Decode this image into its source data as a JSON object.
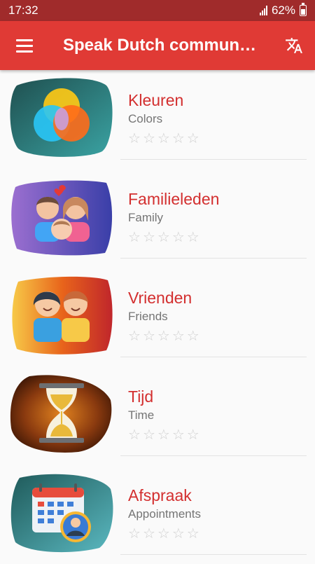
{
  "status": {
    "time": "17:32",
    "battery": "62%"
  },
  "app_bar": {
    "title": "Speak Dutch communic…"
  },
  "topics": [
    {
      "title": "Kleuren",
      "subtitle": "Colors",
      "icon": "colors-icon",
      "rating": 0
    },
    {
      "title": "Familieleden",
      "subtitle": "Family",
      "icon": "family-icon",
      "rating": 0
    },
    {
      "title": "Vrienden",
      "subtitle": "Friends",
      "icon": "friends-icon",
      "rating": 0
    },
    {
      "title": "Tijd",
      "subtitle": "Time",
      "icon": "hourglass-icon",
      "rating": 0
    },
    {
      "title": "Afspraak",
      "subtitle": "Appointments",
      "icon": "calendar-icon",
      "rating": 0
    }
  ],
  "colors": {
    "accent": "#e03a35",
    "status_bar": "#a02b2b",
    "title_text": "#d32f2f"
  }
}
